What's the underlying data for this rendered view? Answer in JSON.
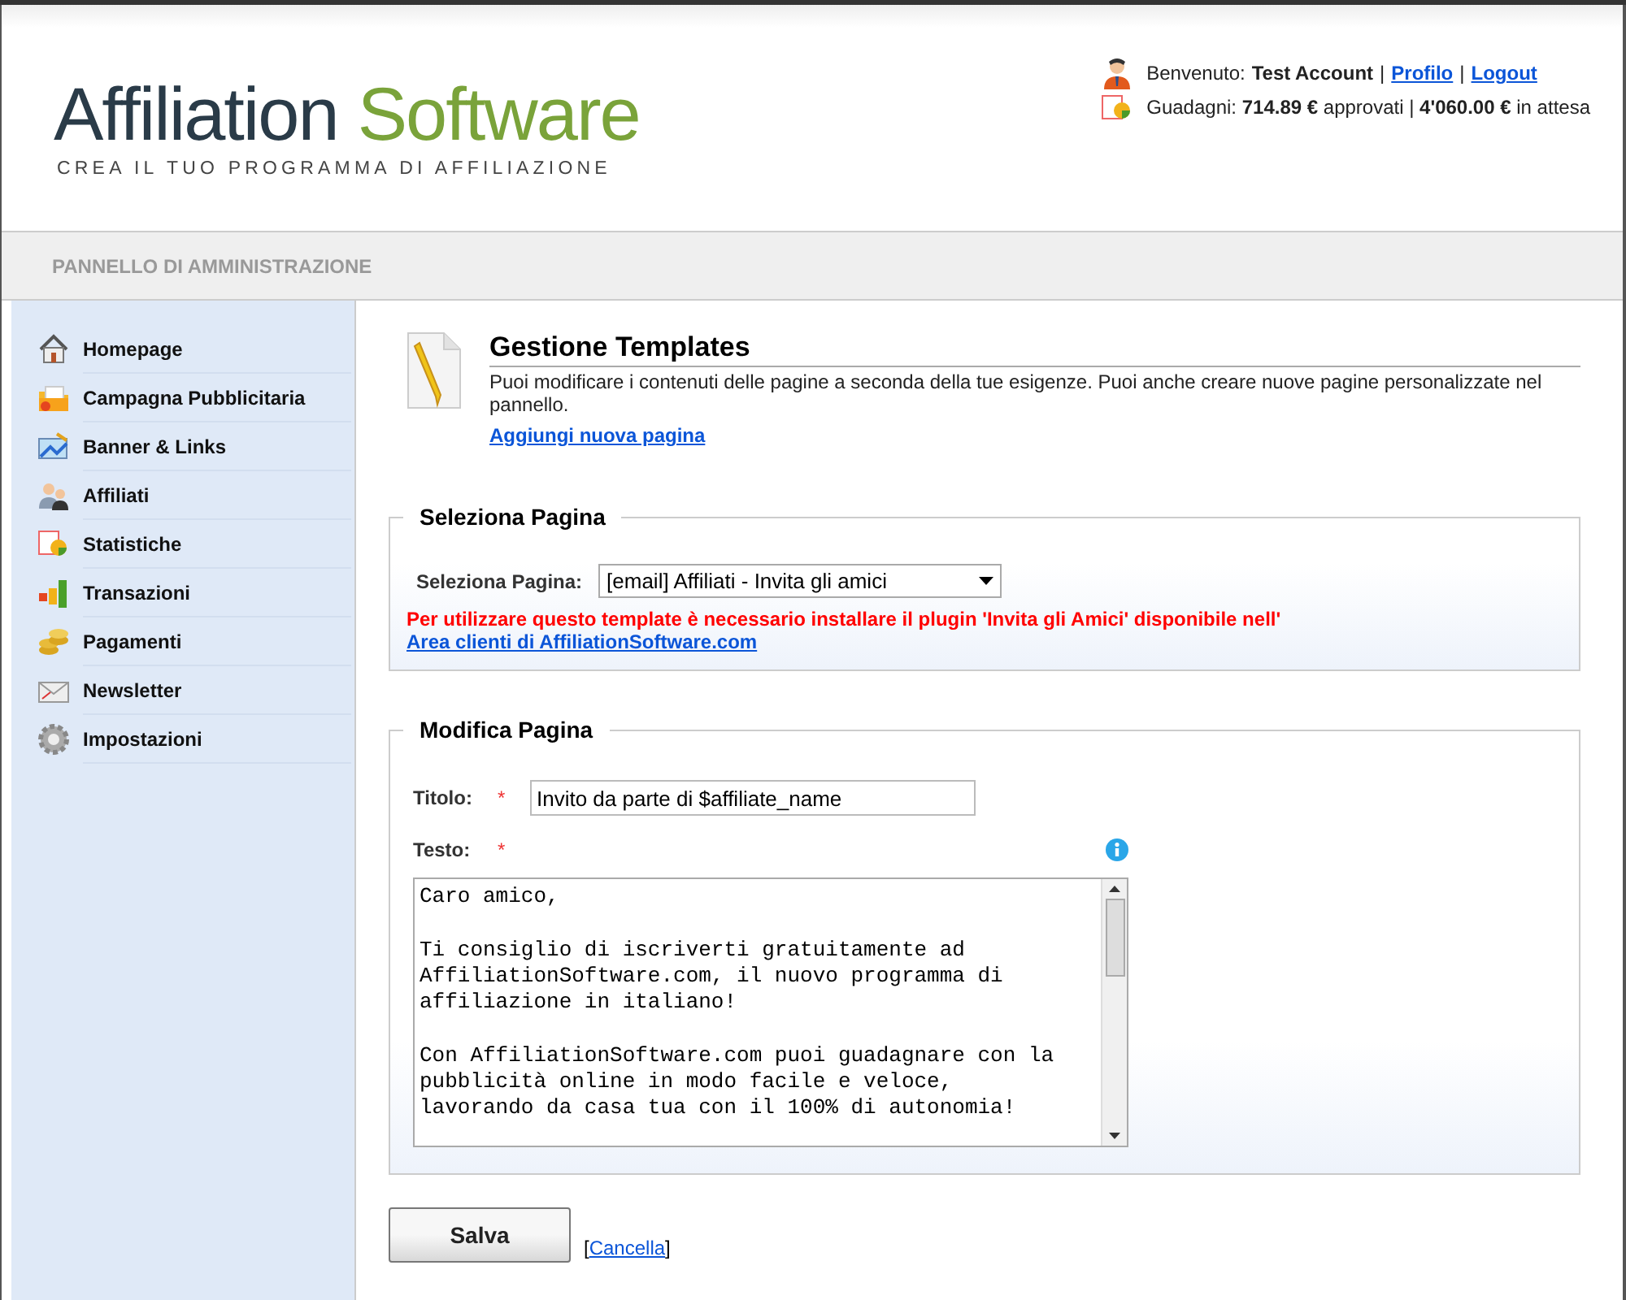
{
  "logo": {
    "word_1": "Affiliation",
    "word_2": "Software",
    "tagline": "CREA IL TUO PROGRAMMA DI AFFILIAZIONE"
  },
  "user_box": {
    "welcome_label": "Benvenuto:",
    "user_name": "Test Account",
    "separator_1": "|",
    "profile_link": "Profilo",
    "separator_2": "|",
    "logout_link": "Logout",
    "earnings": "Guadagni: **714.89 €** approvati | **4'060.00 €** in attesa"
  },
  "panel_bar": {
    "title": "PANNELLO DI AMMINISTRAZIONE"
  },
  "sidebar": {
    "items": [
      {
        "label": "Homepage",
        "kind": "home"
      },
      {
        "label": "Campagna Pubblicitaria",
        "kind": "folder"
      },
      {
        "label": "Banner & Links",
        "kind": "picture"
      },
      {
        "label": "Affiliati",
        "kind": "people"
      },
      {
        "label": "Statistiche",
        "kind": "stats"
      },
      {
        "label": "Transazioni",
        "kind": "bars"
      },
      {
        "label": "Pagamenti",
        "kind": "coins"
      },
      {
        "label": "Newsletter",
        "kind": "mail"
      },
      {
        "label": "Impostazioni",
        "kind": "gear"
      }
    ]
  },
  "page": {
    "title": "Gestione Templates",
    "description": "Puoi modificare i contenuti delle pagine a seconda della tue esigenze. Puoi anche creare nuove pagine personalizzate nel pannello.",
    "add_link": "Aggiungi nuova pagina"
  },
  "select_section": {
    "legend": "Seleziona Pagina",
    "field_label": "Seleziona Pagina:",
    "value": "[email] Affiliati - Invita gli amici",
    "warning": "Per utilizzare questo template è necessario installare il plugin 'Invita gli Amici' disponibile nell'",
    "warning_link": "Area clienti di AffiliationSoftware.com"
  },
  "edit_section": {
    "legend": "Modifica Pagina",
    "title_label": "Titolo:",
    "title_required": "*",
    "title_value": "Invito da parte di $affiliate_name",
    "text_label": "Testo:",
    "text_required": "*",
    "text_value": "Caro amico,\n\nTi consiglio di iscriverti gratuitamente ad\nAffiliationSoftware.com, il nuovo programma di\naffiliazione in italiano!\n\nCon AffiliationSoftware.com puoi guadagnare con la\npubblicità online in modo facile e veloce,\nlavorando da casa tua con il 100% di autonomia!"
  },
  "actions": {
    "save_button": "Salva",
    "bracket_open": "[",
    "cancel_link": "Cancella",
    "bracket_close": "]"
  }
}
